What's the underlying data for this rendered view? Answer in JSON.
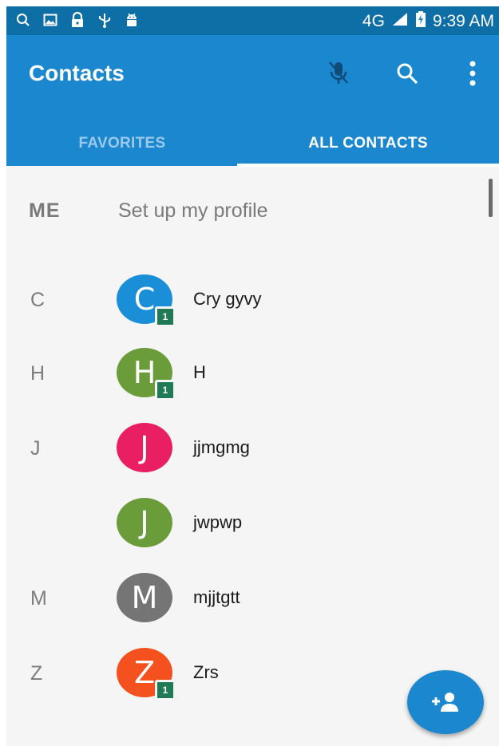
{
  "status_bar": {
    "network": "4G",
    "time": "9:39 AM",
    "icons": [
      "search-icon",
      "image-icon",
      "lock-icon",
      "usb-icon",
      "android-icon",
      "signal-icon",
      "battery-charging-icon"
    ]
  },
  "app_bar": {
    "title": "Contacts",
    "actions": [
      "mic-off-icon",
      "search-icon",
      "more-vert-icon"
    ]
  },
  "tabs": [
    {
      "label": "FAVORITES",
      "selected": false
    },
    {
      "label": "ALL CONTACTS",
      "selected": true
    }
  ],
  "me_row": {
    "label": "ME",
    "text": "Set up my profile"
  },
  "contacts": [
    {
      "section": "C",
      "initial": "C",
      "name": "Cry gyvy",
      "color": "#1a8fd8",
      "badge": "1"
    },
    {
      "section": "H",
      "initial": "H",
      "name": "H",
      "color": "#6a9c3a",
      "badge": "1"
    },
    {
      "section": "J",
      "initial": "J",
      "name": "jjmgmg",
      "color": "#e91e63",
      "badge": ""
    },
    {
      "section": "",
      "initial": "J",
      "name": "jwpwp",
      "color": "#6a9c3a",
      "badge": ""
    },
    {
      "section": "M",
      "initial": "M",
      "name": "mjjtgtt",
      "color": "#757575",
      "badge": ""
    },
    {
      "section": "Z",
      "initial": "Z",
      "name": "Zrs",
      "color": "#f4511e",
      "badge": "1"
    }
  ],
  "fab": {
    "icon": "add-person-icon"
  },
  "colors": {
    "primary": "#1a87cf",
    "status_bar": "#0e6ea6",
    "background": "#f5f5f5"
  }
}
